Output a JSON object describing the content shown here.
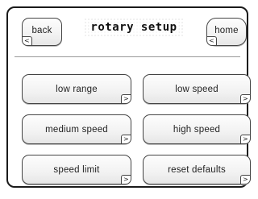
{
  "header": {
    "title": "rotary setup",
    "back_label": "back",
    "back_arrow": "<",
    "home_label": "home",
    "home_arrow": "<"
  },
  "buttons": [
    {
      "label": "low range",
      "arrow": ">"
    },
    {
      "label": "low speed",
      "arrow": ">"
    },
    {
      "label": "medium speed",
      "arrow": ">"
    },
    {
      "label": "high speed",
      "arrow": ">"
    },
    {
      "label": "speed limit",
      "arrow": ">"
    },
    {
      "label": "reset defaults",
      "arrow": ">"
    }
  ],
  "colors": {
    "border": "#1a1a1a",
    "button_face": "#f2f2f2",
    "text": "#222222"
  }
}
